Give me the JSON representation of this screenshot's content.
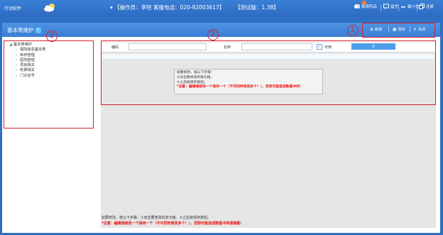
{
  "header": {
    "logo_text": "行动软件",
    "operator": "【操作员：李恒",
    "hotline": "客服电话：020-82003617】",
    "version": "【测试版：1.38】",
    "actions": [
      {
        "label": "新增药品",
        "icon": "pills-icon"
      },
      {
        "label": "留言",
        "icon": "message-icon"
      },
      {
        "label": "最小化",
        "icon": "minimize-icon"
      },
      {
        "label": "还原",
        "icon": "restore-icon"
      },
      {
        "label": "退出系统",
        "icon": "logout-icon"
      }
    ]
  },
  "panel": {
    "title": "基本表维护",
    "help": "?",
    "toolbar": {
      "add": "新增",
      "save": "保存",
      "close": "关闭"
    }
  },
  "tree": {
    "root": "基本表维护",
    "items": [
      "属院信息基本表",
      "库存管理",
      "医院管理",
      "项目相关",
      "收费相关",
      "门诊挂号"
    ]
  },
  "search": {
    "code_label": "编码",
    "name_label": "名称",
    "check_mark": "✓",
    "available_label": "可用",
    "search_icon": "search-icon"
  },
  "tip": {
    "line1": "如要修改，按以下步骤：",
    "line2": "①双击要修改的单元格。",
    "line3": "②之后按保存按钮。",
    "warning": "*注意：编辑请修改一个保存一个（不可同时修改多个！），否则可能造成数据冲突！"
  },
  "bottom_help": {
    "line1": "如要修改，按以下步骤：①双击要修改的单元格。②之后按保存按钮。",
    "warning": "*注意：编辑请修改一个保存一个（不可同时修改多个！），否则可能造成数据冲突请慎重！"
  },
  "markers": [
    "1",
    "2",
    "3"
  ],
  "colors": {
    "header_blue": "#2f6fc4",
    "annotation_red": "#d3202f",
    "warning_red": "#e11111"
  }
}
